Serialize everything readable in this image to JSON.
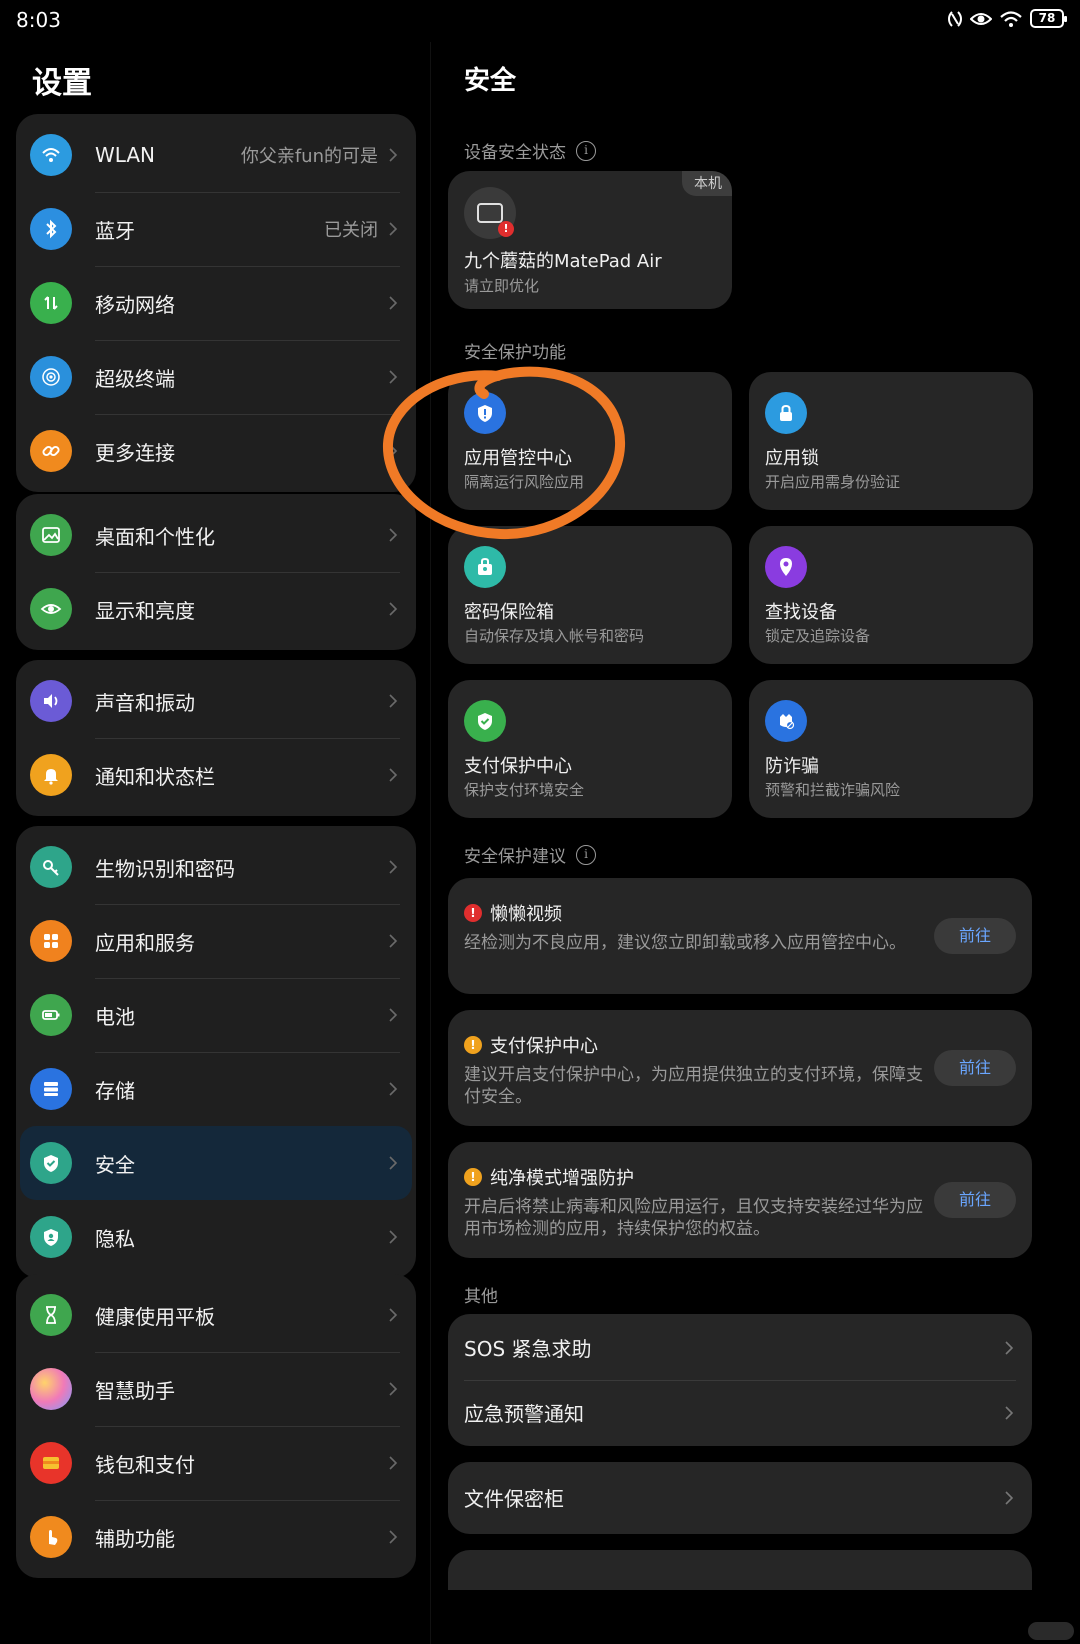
{
  "status_bar": {
    "time": "8:03",
    "battery": "78"
  },
  "left": {
    "title": "设置",
    "groups": [
      [
        {
          "label": "WLAN",
          "value": "你父亲fun的可是",
          "icon": "wifi-icon",
          "color": "#2c9be0"
        },
        {
          "label": "蓝牙",
          "value": "已关闭",
          "icon": "bluetooth-icon",
          "color": "#2c8fe0"
        },
        {
          "label": "移动网络",
          "icon": "mobile-network-icon",
          "color": "#39b04d"
        },
        {
          "label": "超级终端",
          "icon": "super-device-icon",
          "color": "#2a90dc"
        },
        {
          "label": "更多连接",
          "icon": "link-icon",
          "color": "#f08a1e"
        }
      ],
      [
        {
          "label": "桌面和个性化",
          "icon": "image-icon",
          "color": "#3fa64e"
        },
        {
          "label": "显示和亮度",
          "icon": "eye-icon",
          "color": "#3fa64e"
        }
      ],
      [
        {
          "label": "声音和振动",
          "icon": "speaker-icon",
          "color": "#6b5bd6"
        },
        {
          "label": "通知和状态栏",
          "icon": "bell-icon",
          "color": "#f0a21e"
        }
      ],
      [
        {
          "label": "生物识别和密码",
          "icon": "key-icon",
          "color": "#2ea58a"
        },
        {
          "label": "应用和服务",
          "icon": "apps-icon",
          "color": "#f0821e"
        },
        {
          "label": "电池",
          "icon": "battery-icon",
          "color": "#3fa64e"
        },
        {
          "label": "存储",
          "icon": "storage-icon",
          "color": "#2a73e0"
        },
        {
          "label": "安全",
          "icon": "shield-check-icon",
          "color": "#2ea58a",
          "selected": true
        },
        {
          "label": "隐私",
          "icon": "privacy-icon",
          "color": "#2ea58a"
        }
      ],
      [
        {
          "label": "健康使用平板",
          "icon": "hourglass-icon",
          "color": "#3fa64e"
        },
        {
          "label": "智慧助手",
          "icon": "assistant-icon",
          "color": "#b478e0"
        },
        {
          "label": "钱包和支付",
          "icon": "wallet-icon",
          "color": "#e8342a"
        },
        {
          "label": "辅助功能",
          "icon": "hand-icon",
          "color": "#f08a1e"
        }
      ]
    ]
  },
  "right": {
    "title": "安全",
    "device_section": "设备安全状态",
    "device": {
      "badge": "本机",
      "name": "九个蘑菇的MatePad Air",
      "status": "请立即优化"
    },
    "protection_section": "安全保护功能",
    "features": [
      {
        "title": "应用管控中心",
        "sub": "隔离运行风险应用",
        "icon": "shield-alert-icon",
        "color": "#2a73e0"
      },
      {
        "title": "应用锁",
        "sub": "开启应用需身份验证",
        "icon": "lock-icon",
        "color": "#2c9be0"
      },
      {
        "title": "密码保险箱",
        "sub": "自动保存及填入帐号和密码",
        "icon": "safe-icon",
        "color": "#2ebaa8"
      },
      {
        "title": "查找设备",
        "sub": "锁定及追踪设备",
        "icon": "location-icon",
        "color": "#8a3ce0"
      },
      {
        "title": "支付保护中心",
        "sub": "保护支付环境安全",
        "icon": "pay-shield-icon",
        "color": "#39b04d"
      },
      {
        "title": "防诈骗",
        "sub": "预警和拦截诈骗风险",
        "icon": "anti-fraud-icon",
        "color": "#2a73e0"
      }
    ],
    "advice_section": "安全保护建议",
    "advice": [
      {
        "title": "懒懒视频",
        "body": "经检测为不良应用，建议您立即卸载或移入应用管控中心。",
        "dot_color": "#e02e2e",
        "button": "前往"
      },
      {
        "title": "支付保护中心",
        "body": "建议开启支付保护中心，为应用提供独立的支付环境，保障支付安全。",
        "dot_color": "#f0a21e",
        "button": "前往"
      },
      {
        "title": "纯净模式增强防护",
        "body": "开启后将禁止病毒和风险应用运行，且仅支持安装经过华为应用市场检测的应用，持续保护您的权益。",
        "dot_color": "#f0a21e",
        "button": "前往"
      }
    ],
    "other_section": "其他",
    "other_items": [
      "SOS 紧急求助",
      "应急预警通知"
    ],
    "file_safe": "文件保密柜"
  },
  "annotation_color": "#f07a26"
}
